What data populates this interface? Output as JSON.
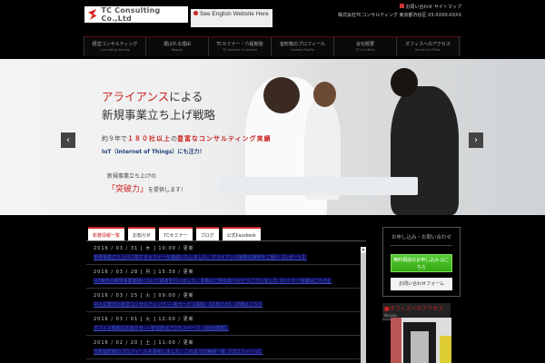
{
  "header": {
    "logo_text": "TC Consulting Co.,Ltd",
    "english_button": "See English Website Here",
    "top_links_1": "お問い合わせ  サイトマップ",
    "top_links_2": "株式会社TCコンサルティング  東京都渋谷区 03-XXXX-XXXX"
  },
  "nav": [
    {
      "label": "経営コンサルティング",
      "sub": "Consulting Service"
    },
    {
      "label": "選ばれる理由",
      "sub": "Reason"
    },
    {
      "label": "TCセミナー・介紹勉強",
      "sub": "TC Seminar & Lecture"
    },
    {
      "label": "室町龍のプロフィール",
      "sub": "Careers Profile"
    },
    {
      "label": "会社概要",
      "sub": "TC's Outline"
    },
    {
      "label": "オフィスへのアクセス",
      "sub": "Access to Office"
    }
  ],
  "hero": {
    "line1_red": "アライアンス",
    "line1_rest": "による",
    "line2": "新規事業立ち上げ戦略",
    "line3_pre": "約９年で",
    "line3_red": "１８０社以上",
    "line3_mid": "の",
    "line3_red2": "豊富なコンサルティング実績",
    "line4": "IoT（Internet of Things）にも注力！",
    "line5": "新規事業立ち上げの",
    "line6_red": "「突破力」",
    "line6_rest": "を提供します！",
    "prev": "‹",
    "next": "›"
  },
  "tabs": [
    "新着情報一覧",
    "お知らせ",
    "TCセミナー",
    "ブログ",
    "公式Facebook"
  ],
  "news": [
    {
      "date": "2016 / 03 / 31 [ 木 ] 10:00 / 更新",
      "title": "新規事業立ち上げに関するセミナーを開催いたしました。アライアンス戦略の実例をご紹介【レポート】"
    },
    {
      "date": "2016 / 03 / 28 [ 月 ] 15:30 / 更新",
      "title": "IoT時代の新規事業開発について講演を行いました。多数のご参加ありがとうございました【セミナー情報はこちら】"
    },
    {
      "date": "2016 / 03 / 15 [ 火 ] 09:00 / 更新",
      "title": "中小企業向け経営コンサルティング ― 新サービス開始 【お知らせ】 詳細はこちら"
    },
    {
      "date": "2016 / 03 / 01 [ 火 ] 12:00 / 更新",
      "title": "オフィス移転のお知らせ ― 新住所はアクセスページ 【会社概要】"
    },
    {
      "date": "2016 / 02 / 20 [ 土 ] 11:00 / 更新",
      "title": "代表室町龍のプロフィールを更新しました。これまでの実績一覧 【プロフィール】"
    }
  ],
  "sidebar": {
    "title": "お申し込み・お問い合わせ",
    "green_button": "無料相談のお申し込み はこちら",
    "white_button": "お問い合わせフォーム",
    "access": "オフィスへのアクセス",
    "access_sub": "Access"
  }
}
